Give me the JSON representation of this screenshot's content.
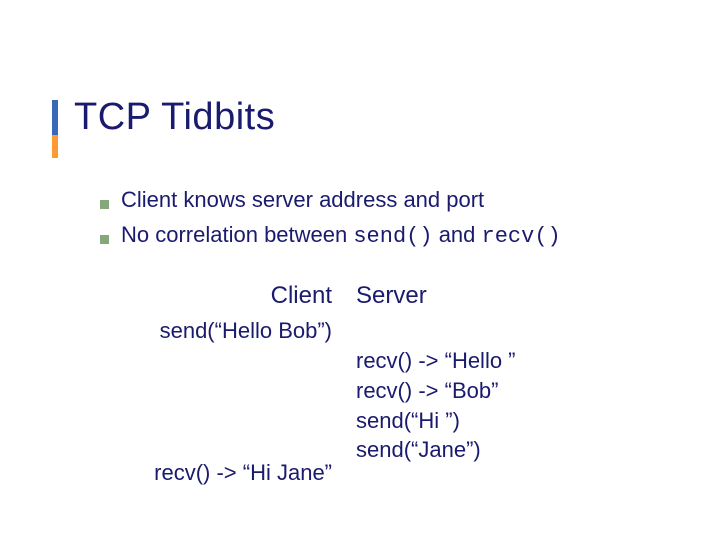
{
  "title": "TCP Tidbits",
  "bullets": [
    {
      "prefix": "Client knows server address and port",
      "code1": "",
      "mid": "",
      "code2": ""
    },
    {
      "prefix": "No correlation between ",
      "code1": "send()",
      "mid": " and ",
      "code2": "recv()"
    }
  ],
  "example": {
    "client_header": "Client",
    "server_header": "Server",
    "client_lines": [
      "send(“Hello Bob”)",
      "",
      "",
      "",
      "",
      "recv() -> “Hi Jane”"
    ],
    "server_lines": [
      "",
      "recv() -> “Hello ”",
      "recv() -> “Bob”",
      "send(“Hi ”)",
      "send(“Jane”)",
      ""
    ]
  }
}
